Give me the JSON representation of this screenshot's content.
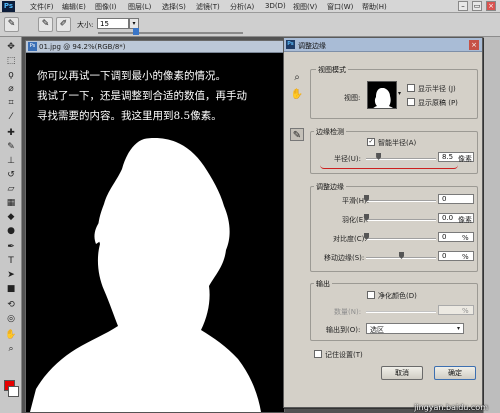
{
  "menubar": {
    "logo": "Ps",
    "items": [
      "文件(F)",
      "编辑(E)",
      "图像(I)",
      "图层(L)",
      "选择(S)",
      "滤镜(T)",
      "分析(A)",
      "3D(D)",
      "视图(V)",
      "窗口(W)",
      "帮助(H)"
    ],
    "window_controls": [
      "–",
      "▭",
      "×"
    ]
  },
  "optbar": {
    "size_label": "大小:",
    "size_value": "15",
    "dropdown_glyph": "▾"
  },
  "document": {
    "title": "01.jpg @ 94.2%(RGB/8*)",
    "file_icon": "Ps",
    "note_lines": [
      "你可以再试一下调到最小的像素的情况。",
      "我试了一下，还是调整到合适的数值，再手动",
      "寻找需要的内容。我这里用到8.5像素。"
    ]
  },
  "dialog": {
    "title": "调整边缘",
    "view_mode": {
      "group_label": "视图模式",
      "view_label": "视图:",
      "show_radius": "显示半径 (J)",
      "show_original": "显示原稿 (P)"
    },
    "edge_detection": {
      "group_label": "边缘检测",
      "smart_radius": "智能半径(A)",
      "smart_radius_checked": true,
      "radius_label": "半径(U):",
      "radius_value": "8.5",
      "radius_unit": "像素",
      "radius_fraction": 0.03
    },
    "adjust_edge": {
      "group_label": "调整边缘",
      "rows": [
        {
          "label": "平滑(H):",
          "value": "0",
          "unit": "",
          "fraction": 0.0
        },
        {
          "label": "羽化(E):",
          "value": "0.0",
          "unit": "像素",
          "fraction": 0.0
        },
        {
          "label": "对比度(C):",
          "value": "0",
          "unit": "%",
          "fraction": 0.0
        },
        {
          "label": "移动边缘(S):",
          "value": "0",
          "unit": "%",
          "fraction": 0.5
        }
      ]
    },
    "output": {
      "group_label": "输出",
      "decontaminate": "净化颜色(D)",
      "amount_label": "数量(N):",
      "amount_unit": "%",
      "output_to_label": "输出到(O):",
      "output_to_value": "选区"
    },
    "remember": "记住设置(T)",
    "cancel": "取消",
    "ok": "确定"
  },
  "watermark": "jingyan.baidu.com",
  "colors": {
    "foreground": "#e60000",
    "background": "#ffffff",
    "underline": "#cc1f1f"
  }
}
